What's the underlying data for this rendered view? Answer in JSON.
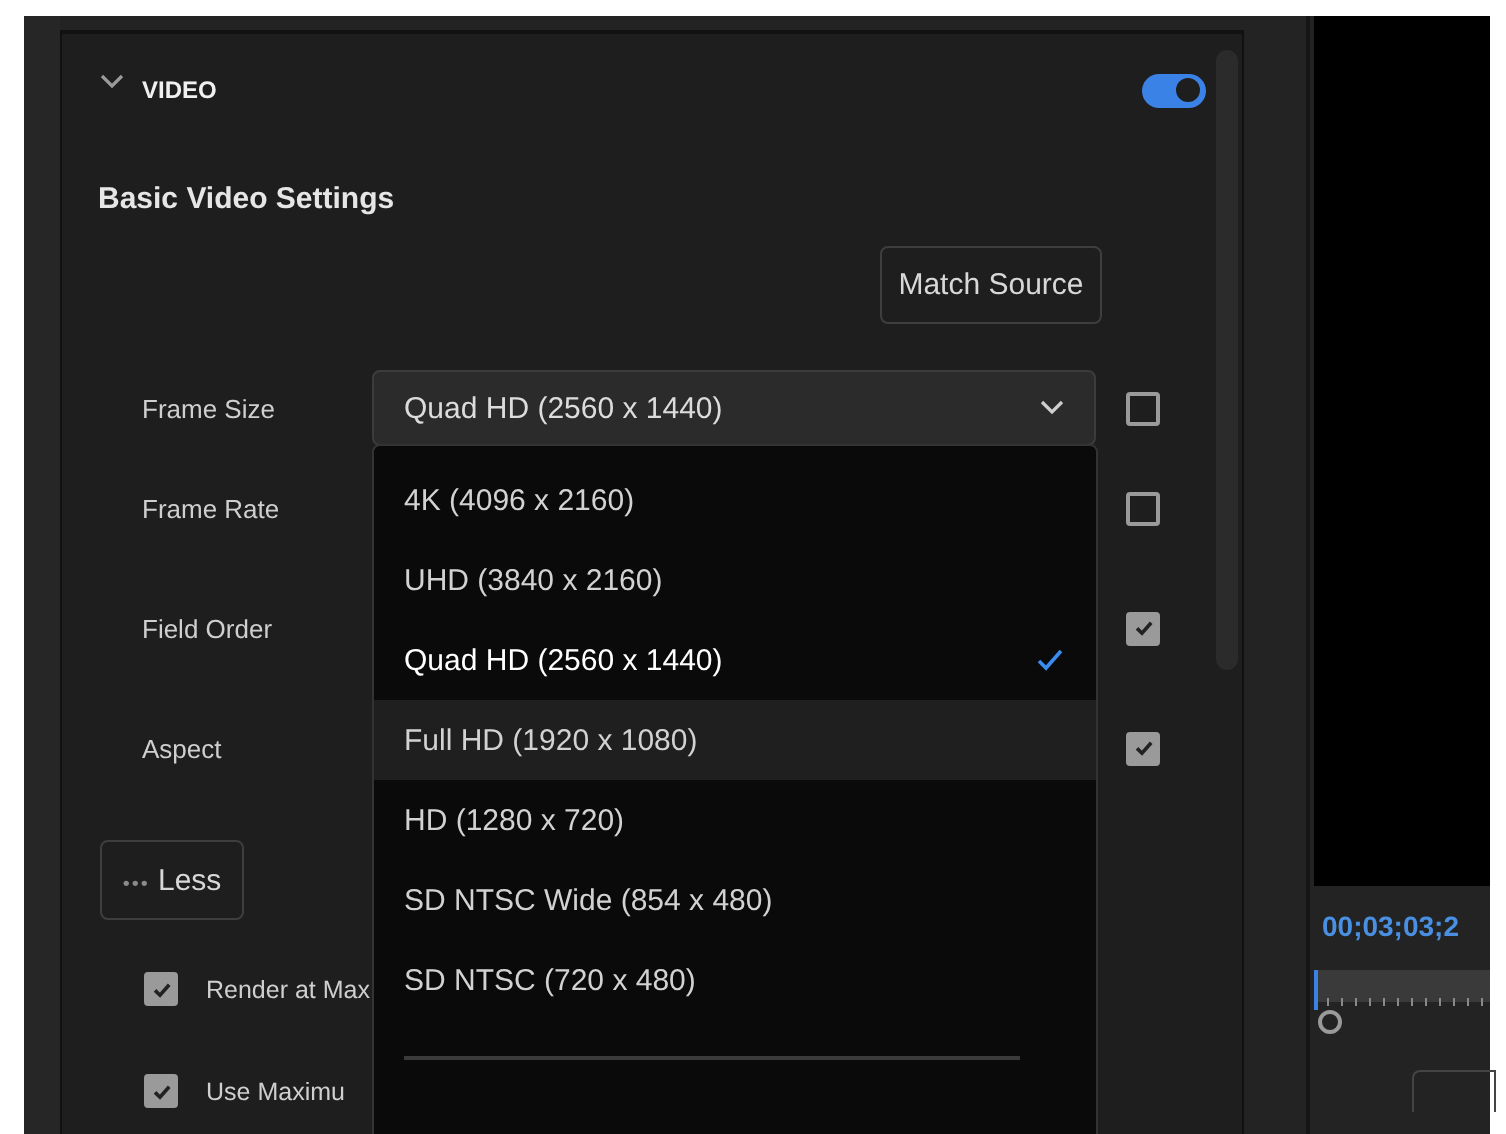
{
  "section": {
    "title": "VIDEO",
    "expanded": true,
    "enabled": true
  },
  "heading": "Basic Video Settings",
  "match_button": "Match Source",
  "settings": [
    {
      "label": "Frame Size",
      "value": "Quad HD (2560 x 1440)",
      "checked": false
    },
    {
      "label": "Frame Rate",
      "checked": false
    },
    {
      "label": "Field Order",
      "checked": true
    },
    {
      "label": "Aspect",
      "checked": true
    }
  ],
  "dropdown": {
    "items": [
      {
        "label": "4K (4096 x 2160)",
        "selected": false,
        "hovered": false
      },
      {
        "label": "UHD (3840 x 2160)",
        "selected": false,
        "hovered": false
      },
      {
        "label": "Quad HD (2560 x 1440)",
        "selected": true,
        "hovered": false
      },
      {
        "label": "Full HD (1920 x 1080)",
        "selected": false,
        "hovered": true
      },
      {
        "label": "HD (1280 x 720)",
        "selected": false,
        "hovered": false
      },
      {
        "label": "SD NTSC Wide (854 x 480)",
        "selected": false,
        "hovered": false
      },
      {
        "label": "SD NTSC (720 x 480)",
        "selected": false,
        "hovered": false
      }
    ]
  },
  "less_button": {
    "icon": "•••",
    "label": "Less"
  },
  "options": [
    {
      "label": "Render at Max",
      "checked": true
    },
    {
      "label": "Use Maximu",
      "checked": true
    }
  ],
  "monitor": {
    "timecode": "00;03;03;2"
  }
}
